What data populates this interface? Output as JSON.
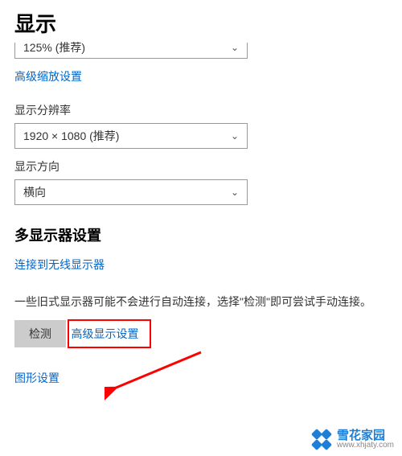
{
  "page": {
    "title": "显示"
  },
  "scaling": {
    "value": "125% (推荐)",
    "advanced_link": "高级缩放设置"
  },
  "resolution": {
    "label": "显示分辨率",
    "value": "1920 × 1080 (推荐)"
  },
  "orientation": {
    "label": "显示方向",
    "value": "横向"
  },
  "multi_display": {
    "title": "多显示器设置",
    "connect_link": "连接到无线显示器",
    "description": "一些旧式显示器可能不会进行自动连接，选择\"检测\"即可尝试手动连接。",
    "detect_button": "检测",
    "advanced_link": "高级显示设置",
    "graphics_link": "图形设置"
  },
  "watermark": {
    "title": "雪花家园",
    "url": "www.xhjaty.com"
  }
}
